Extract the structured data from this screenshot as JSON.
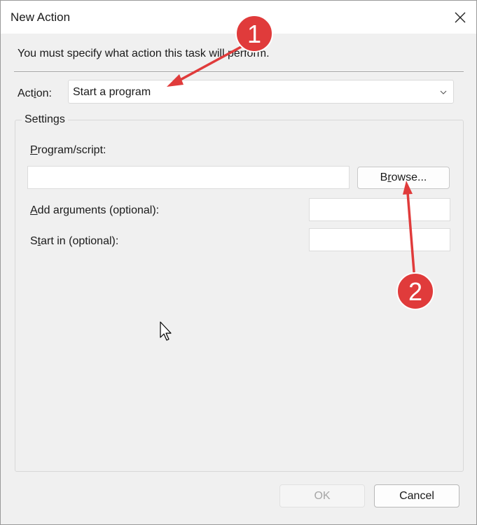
{
  "window": {
    "title": "New Action"
  },
  "instruction": "You must specify what action this task will perform.",
  "action": {
    "label_pre": "Act",
    "label_u": "i",
    "label_post": "on:",
    "selected": "Start a program"
  },
  "settings": {
    "group_title": "Settings",
    "program_label_u": "P",
    "program_label_rest": "rogram/script:",
    "program_value": "",
    "browse_pre": "B",
    "browse_u": "r",
    "browse_post": "owse...",
    "args_label_u": "A",
    "args_label_rest": "dd arguments (optional):",
    "args_value": "",
    "startin_label_pre": "S",
    "startin_label_u": "t",
    "startin_label_post": "art in (optional):",
    "startin_value": ""
  },
  "buttons": {
    "ok": "OK",
    "cancel": "Cancel"
  },
  "annotations": [
    {
      "number": "1",
      "color": "#e03b3b"
    },
    {
      "number": "2",
      "color": "#e03b3b"
    }
  ],
  "icons": {
    "close": "close-icon",
    "dropdown": "chevron-down-icon",
    "cursor": "mouse-pointer-icon"
  }
}
